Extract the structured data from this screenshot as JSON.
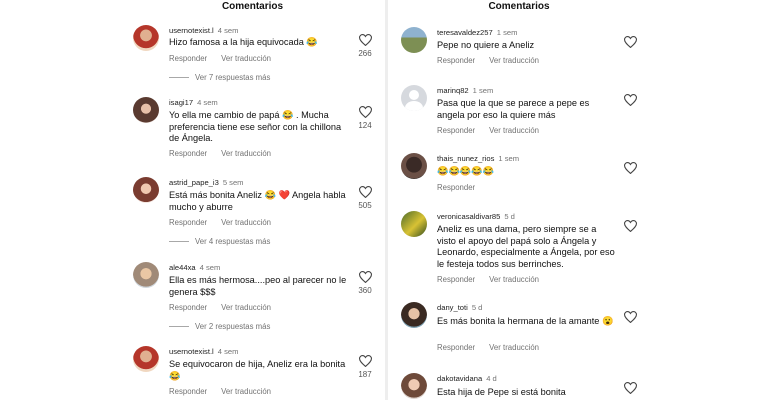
{
  "left_panel": {
    "title": "Comentarios",
    "comments": [
      {
        "user": "usernotexist.l",
        "time": "4 sem",
        "text": "Hizo famosa a la hija equivocada 😂",
        "likes": "266",
        "reply": "Responder",
        "translate": "Ver traducción",
        "more": "Ver 7 respuestas más"
      },
      {
        "user": "isagi17",
        "time": "4 sem",
        "text": "Yo ella me cambio de papá 😂 . Mucha preferencia tiene ese señor con la chillona de Ángela.",
        "likes": "124",
        "reply": "Responder",
        "translate": "Ver traducción"
      },
      {
        "user": "astrid_pape_i3",
        "time": "5 sem",
        "text": "Está más bonita Aneliz 😂 ❤️ Angela habla mucho y aburre",
        "likes": "505",
        "reply": "Responder",
        "translate": "Ver traducción",
        "more": "Ver 4 respuestas más"
      },
      {
        "user": "ale44xa",
        "time": "4 sem",
        "text": "Ella es más hermosa....peo al parecer no le genera $$$",
        "likes": "360",
        "reply": "Responder",
        "translate": "Ver traducción",
        "more": "Ver 2 respuestas más"
      },
      {
        "user": "usernotexist.l",
        "time": "4 sem",
        "text": "Se equivocaron de hija, Aneliz era la bonita😂",
        "likes": "187",
        "reply": "Responder",
        "translate": "Ver traducción"
      }
    ]
  },
  "right_panel": {
    "title": "Comentarios",
    "comments": [
      {
        "user": "teresavaldez257",
        "time": "1 sem",
        "text": "Pepe no quiere a Aneliz",
        "reply": "Responder",
        "translate": "Ver traducción"
      },
      {
        "user": "marinq82",
        "time": "1 sem",
        "text": "Pasa que la que se parece a pepe es angela por eso la quiere más",
        "reply": "Responder",
        "translate": "Ver traducción"
      },
      {
        "user": "thais_nunez_rios",
        "time": "1 sem",
        "text": "😂😂😂😂😂",
        "reply": "Responder"
      },
      {
        "user": "veronicasaldivar85",
        "time": "5 d",
        "text": "Aneliz es una dama, pero siempre se a visto el apoyo del papá solo a Ángela y Leonardo, especialmente a Ángela, por eso le festeja todos sus berrinches.",
        "reply": "Responder",
        "translate": "Ver traducción"
      },
      {
        "user": "dany_toti",
        "time": "5 d",
        "text": "Es más bonita la hermana de la amante 😮",
        "reply": "Responder",
        "translate": "Ver traducción"
      },
      {
        "user": "dakotavidana",
        "time": "4 d",
        "text": "Esta hija de Pepe si está bonita"
      }
    ]
  }
}
